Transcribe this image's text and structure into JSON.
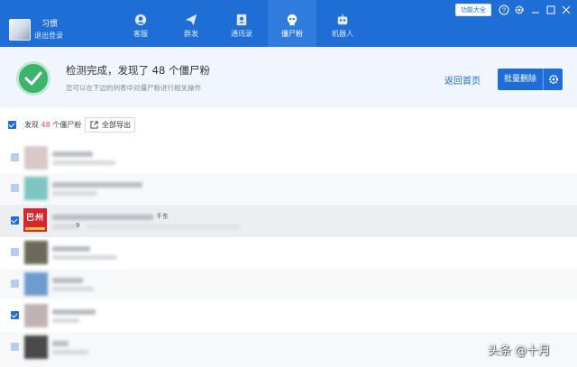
{
  "user": {
    "name": "习惯",
    "logout": "退出登录"
  },
  "nav": [
    {
      "label": "客服",
      "icon": "headset-icon",
      "active": false
    },
    {
      "label": "群发",
      "icon": "send-icon",
      "active": false
    },
    {
      "label": "通讯录",
      "icon": "contacts-icon",
      "active": false
    },
    {
      "label": "僵尸粉",
      "icon": "skull-icon",
      "active": true
    },
    {
      "label": "机器人",
      "icon": "robot-icon",
      "active": false
    }
  ],
  "header": {
    "tools_label": "功能大全"
  },
  "banner": {
    "title_prefix": "检测完成，发现了",
    "count": "48",
    "title_suffix": "个僵尸粉",
    "subtitle": "您可以在下边的列表中对僵尸粉进行相关操作",
    "back_home": "返回首页",
    "bulk_delete": "批量删除"
  },
  "toolbar": {
    "found_prefix": "发现",
    "found_count": "48",
    "found_suffix": "个僵尸粉",
    "export_all": "全部导出"
  },
  "list": {
    "rows": [
      {
        "checked": false,
        "avatar_color": "#d9c8c8"
      },
      {
        "checked": false,
        "avatar_color": "#7fc6c2"
      },
      {
        "checked": true,
        "avatar_label": "巴州",
        "name_tail": "千东",
        "sub_tail": "9"
      },
      {
        "checked": false,
        "avatar_color": "#6a6a5a"
      },
      {
        "checked": false,
        "avatar_color": "#6f9ccf"
      },
      {
        "checked": true,
        "avatar_color": "#bfb3b3"
      },
      {
        "checked": false,
        "avatar_color": "#4a4a4a"
      }
    ]
  },
  "watermark": "头条 @十月",
  "colors": {
    "primary": "#1f6ed6",
    "success": "#3cb46b",
    "count_red": "#e64340"
  }
}
